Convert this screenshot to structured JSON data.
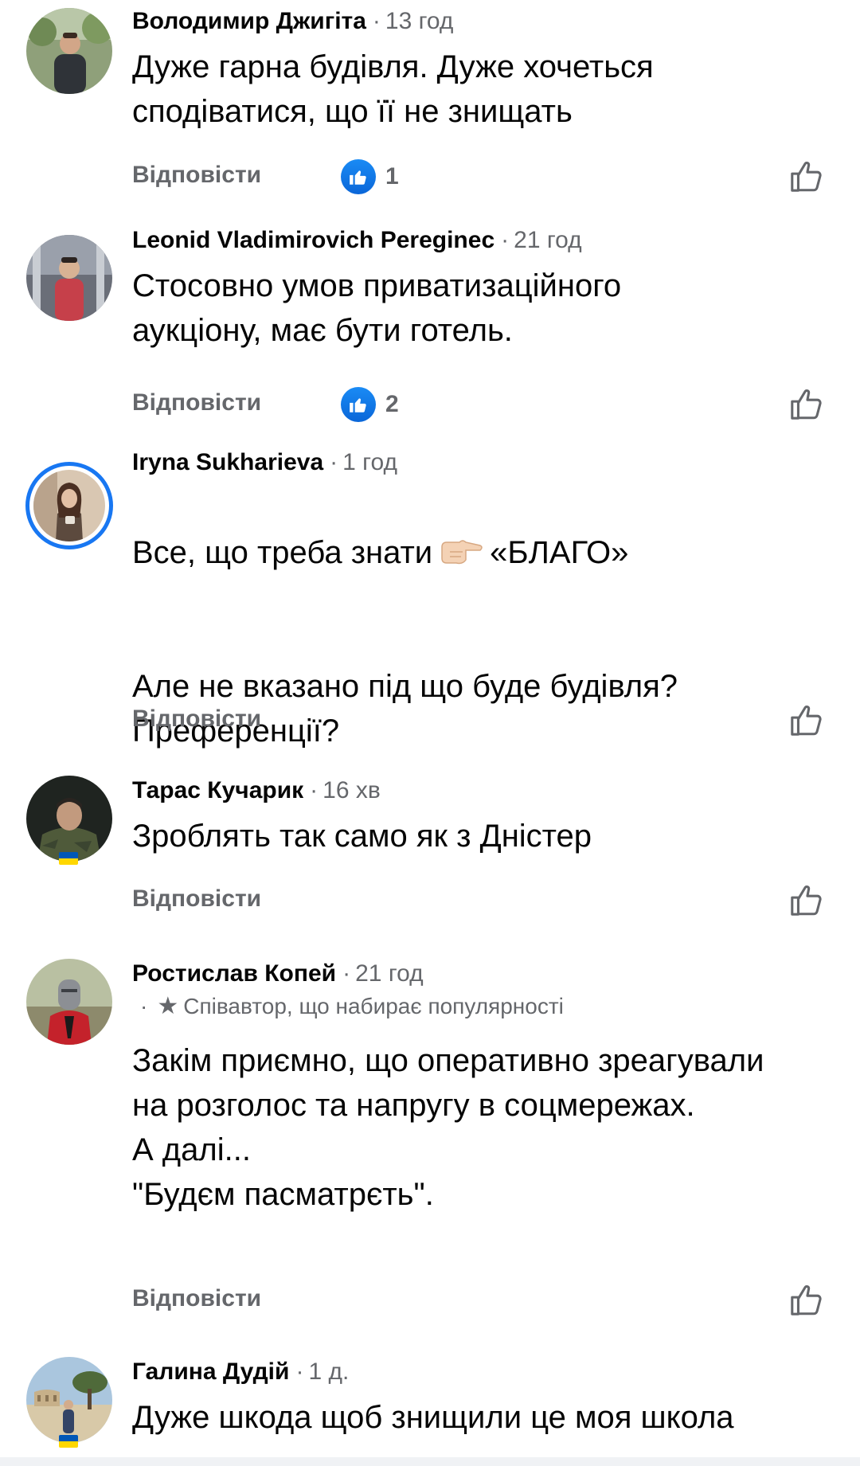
{
  "colors": {
    "author": "#050505",
    "meta": "#65676b",
    "like_blue": "#1877f2",
    "ukraine_blue": "#0057b7",
    "ukraine_yellow": "#ffd700"
  },
  "icons": {
    "like_outline": "thumbs-up-outline-icon",
    "like_reaction": "thumbs-up-filled-icon",
    "star": "star-icon",
    "pointing_hand": "backhand-index-pointing-right-emoji"
  },
  "comments": [
    {
      "author": "Володимир Джигіта",
      "time": "13 год",
      "text": "Дуже гарна будівля. Дуже хочеться сподіватися, що її не знищать",
      "reply_label": "Відповісти",
      "reactions": "1"
    },
    {
      "author": "Leonid Vladimirovich Pereginec",
      "time": "21 год",
      "text": "Стосовно умов приватизаційного аукціону, має бути готель.",
      "reply_label": "Відповісти",
      "reactions": "2"
    },
    {
      "author": "Iryna Sukharieva",
      "time": "1 год",
      "text_before_emoji": "Все, що треба знати",
      "text_after_emoji": "«БЛАГО»",
      "text_second_paragraph": "Але не вказано під що буде будівля? Преференції?",
      "reply_label": "Відповісти"
    },
    {
      "author": "Тарас Кучарик",
      "time": "16 хв",
      "text": "Зроблять так само як з Дністер",
      "reply_label": "Відповісти"
    },
    {
      "author": "Ростислав Копей",
      "time": "21 год",
      "badge": "Співавтор, що набирає популярності",
      "text": "Закім приємно, що оперативно зреагували на розголос та напругу в соцмережах.\nА далі...\n\"Будєм пасматрєть\".",
      "reply_label": "Відповісти"
    },
    {
      "author": "Галина Дудій",
      "time": "1 д.",
      "text": "Дуже шкода щоб знищили це моя школа"
    }
  ]
}
